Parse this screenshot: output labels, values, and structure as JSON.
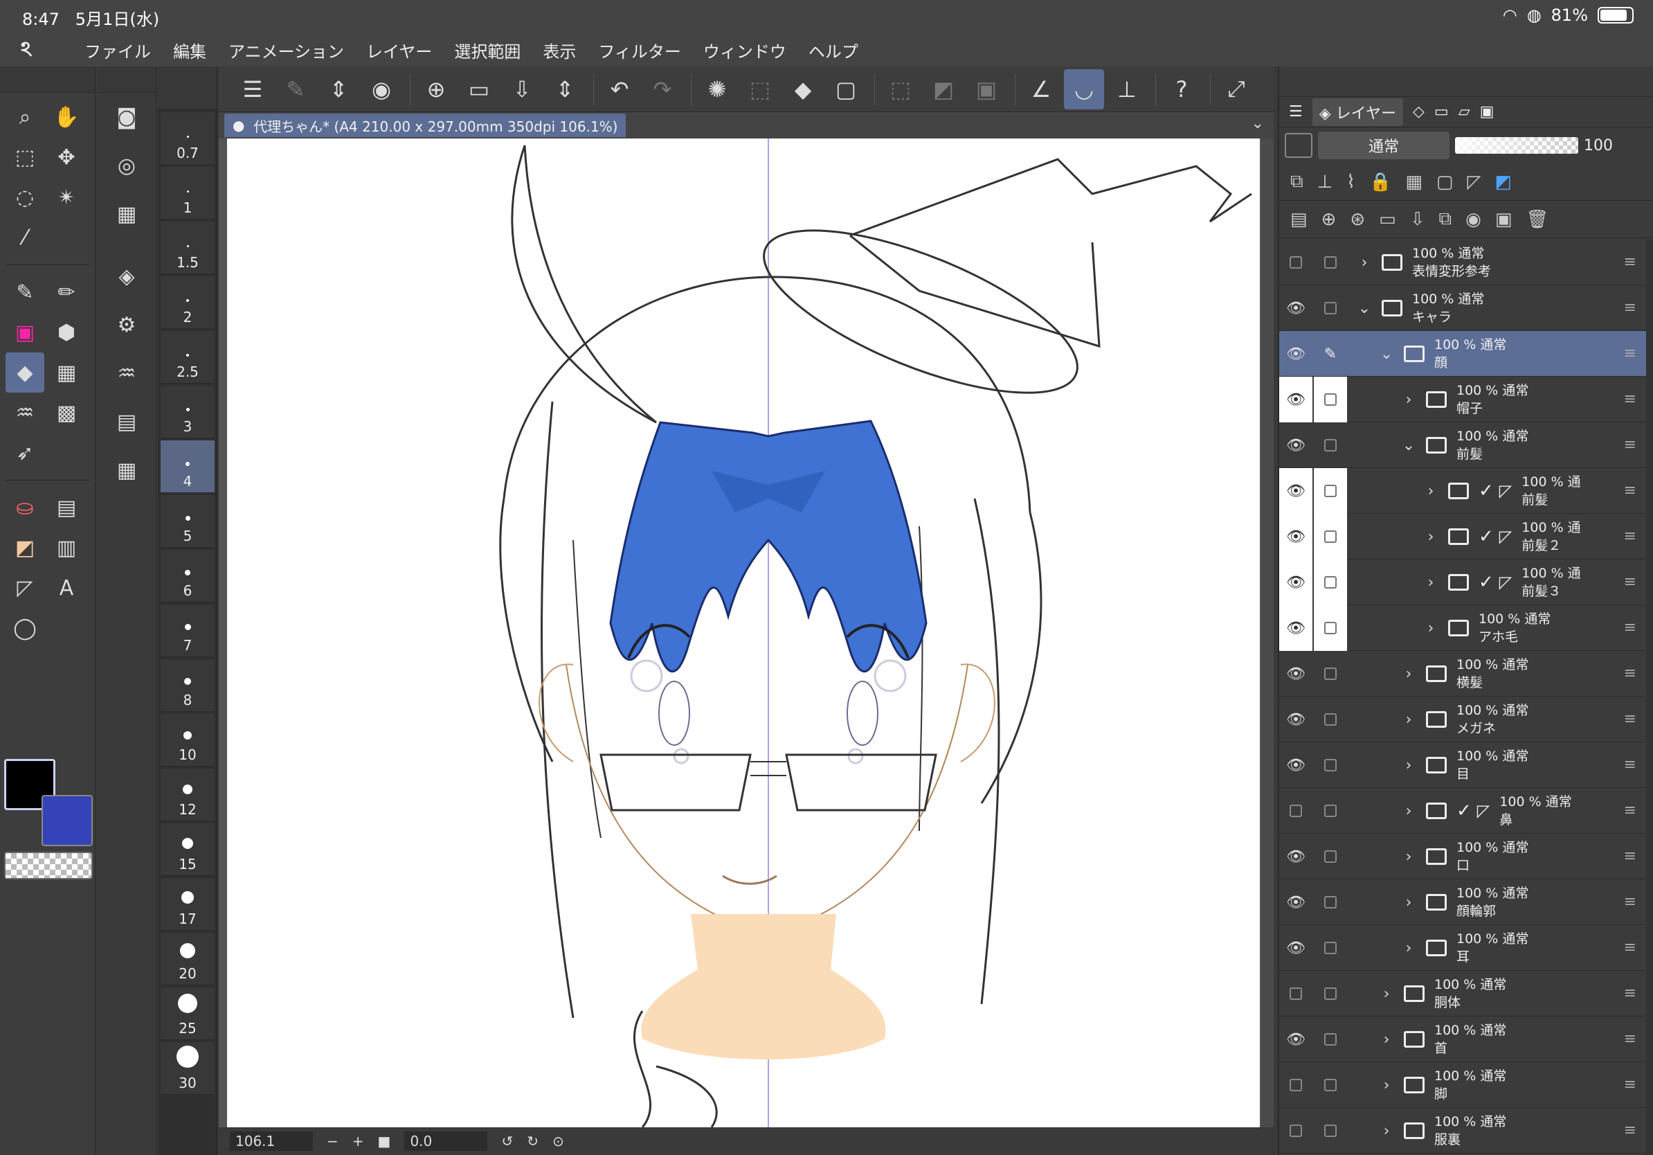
{
  "status_bar": {
    "time": "8:47",
    "date": "5月1日(水)",
    "battery": "81%"
  },
  "menu": [
    "ファイル",
    "編集",
    "アニメーション",
    "レイヤー",
    "選択範囲",
    "表示",
    "フィルター",
    "ウィンドウ",
    "ヘルプ"
  ],
  "canvas": {
    "tab_title": "代理ちゃん* (A4 210.00 x 297.00mm 350dpi 106.1%)",
    "zoom": "106.1",
    "rotation": "0.0"
  },
  "brush_sizes": [
    "0.7",
    "1",
    "1.5",
    "2",
    "2.5",
    "3",
    "4",
    "5",
    "6",
    "7",
    "8",
    "10",
    "12",
    "15",
    "17",
    "20",
    "25",
    "30"
  ],
  "brush_selected": "4",
  "layer_panel": {
    "tab_label": "レイヤー",
    "blend_mode": "通常",
    "opacity": "100",
    "layers": [
      {
        "opacity_mode": "100 % 通常",
        "name": "表情変形参考",
        "indent": 0,
        "expanded": false,
        "visible": false,
        "selected": false
      },
      {
        "opacity_mode": "100 % 通常",
        "name": "キャラ",
        "indent": 0,
        "expanded": true,
        "visible": true,
        "selected": false
      },
      {
        "opacity_mode": "100 % 通常",
        "name": "顔",
        "indent": 1,
        "expanded": true,
        "visible": true,
        "selected": true
      },
      {
        "opacity_mode": "100 % 通常",
        "name": "帽子",
        "indent": 2,
        "expanded": false,
        "visible": true,
        "selected": false,
        "highlight": true
      },
      {
        "opacity_mode": "100 % 通常",
        "name": "前髪",
        "indent": 2,
        "expanded": true,
        "visible": true,
        "selected": false
      },
      {
        "opacity_mode": "100 % 通",
        "name": "前髪",
        "indent": 3,
        "expanded": false,
        "visible": true,
        "selected": false,
        "highlight": true,
        "vector": true
      },
      {
        "opacity_mode": "100 % 通",
        "name": "前髪２",
        "indent": 3,
        "expanded": false,
        "visible": true,
        "selected": false,
        "highlight": true,
        "vector": true
      },
      {
        "opacity_mode": "100 % 通",
        "name": "前髪３",
        "indent": 3,
        "expanded": false,
        "visible": true,
        "selected": false,
        "highlight": true,
        "vector": true
      },
      {
        "opacity_mode": "100 % 通常",
        "name": "アホ毛",
        "indent": 3,
        "expanded": false,
        "visible": true,
        "selected": false,
        "highlight": true
      },
      {
        "opacity_mode": "100 % 通常",
        "name": "横髪",
        "indent": 2,
        "expanded": false,
        "visible": true,
        "selected": false
      },
      {
        "opacity_mode": "100 % 通常",
        "name": "メガネ",
        "indent": 2,
        "expanded": false,
        "visible": true,
        "selected": false
      },
      {
        "opacity_mode": "100 % 通常",
        "name": "目",
        "indent": 2,
        "expanded": false,
        "visible": true,
        "selected": false
      },
      {
        "opacity_mode": "100 % 通常",
        "name": "鼻",
        "indent": 2,
        "expanded": false,
        "visible": false,
        "selected": false,
        "vector": true
      },
      {
        "opacity_mode": "100 % 通常",
        "name": "口",
        "indent": 2,
        "expanded": false,
        "visible": true,
        "selected": false
      },
      {
        "opacity_mode": "100 % 通常",
        "name": "顔輪郭",
        "indent": 2,
        "expanded": false,
        "visible": true,
        "selected": false
      },
      {
        "opacity_mode": "100 % 通常",
        "name": "耳",
        "indent": 2,
        "expanded": false,
        "visible": true,
        "selected": false
      },
      {
        "opacity_mode": "100 % 通常",
        "name": "胴体",
        "indent": 1,
        "expanded": false,
        "visible": false,
        "selected": false
      },
      {
        "opacity_mode": "100 % 通常",
        "name": "首",
        "indent": 1,
        "expanded": false,
        "visible": true,
        "selected": false
      },
      {
        "opacity_mode": "100 % 通常",
        "name": "脚",
        "indent": 1,
        "expanded": false,
        "visible": false,
        "selected": false
      },
      {
        "opacity_mode": "100 % 通常",
        "name": "服裏",
        "indent": 1,
        "expanded": false,
        "visible": false,
        "selected": false
      }
    ]
  },
  "colors": {
    "main": "#000000",
    "sub": "#3443b8",
    "accent": "#5c6e95",
    "hair": "#3c6fd0",
    "skin": "#fbdcb8"
  }
}
